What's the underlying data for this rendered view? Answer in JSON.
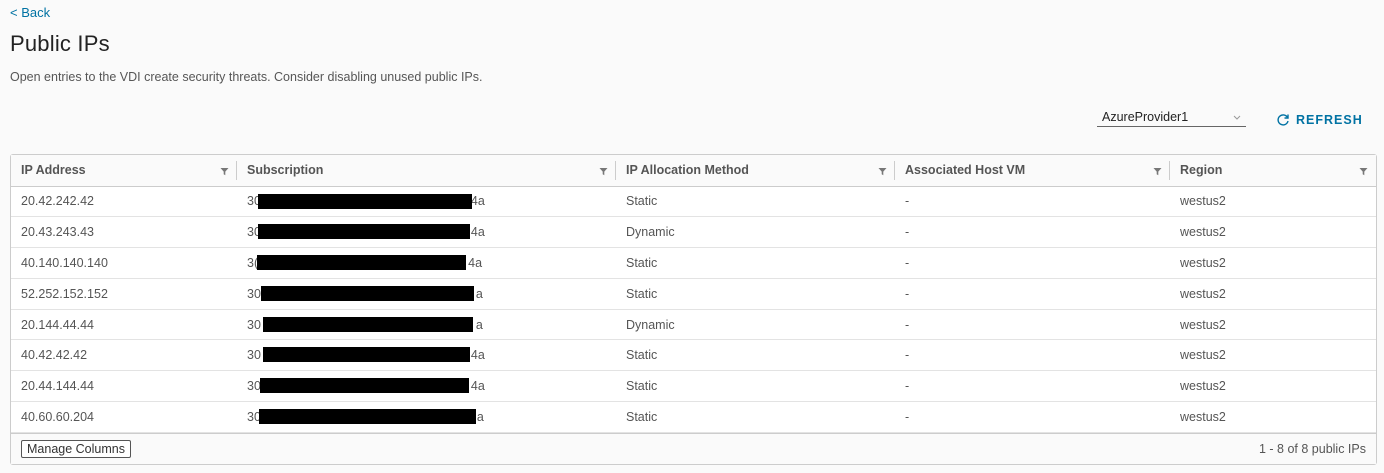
{
  "nav": {
    "back_label": "< Back"
  },
  "page": {
    "title": "Public IPs",
    "description": "Open entries to the VDI create security threats. Consider disabling unused public IPs."
  },
  "toolbar": {
    "provider_selected": "AzureProvider1",
    "refresh_label": "REFRESH"
  },
  "table": {
    "columns": [
      "IP Address",
      "Subscription",
      "IP Allocation Method",
      "Associated Host VM",
      "Region"
    ],
    "rows": [
      {
        "ip": "20.42.242.42",
        "sub_prefix": "30",
        "sub_suffix": "4a",
        "method": "Static",
        "vm": "-",
        "region": "westus2"
      },
      {
        "ip": "20.43.243.43",
        "sub_prefix": "30",
        "sub_suffix": "4a",
        "method": "Dynamic",
        "vm": "-",
        "region": "westus2"
      },
      {
        "ip": "40.140.140.140",
        "sub_prefix": "3(",
        "sub_suffix": "4a",
        "method": "Static",
        "vm": "-",
        "region": "westus2"
      },
      {
        "ip": "52.252.152.152",
        "sub_prefix": "30",
        "sub_suffix": "a",
        "method": "Static",
        "vm": "-",
        "region": "westus2"
      },
      {
        "ip": "20.144.44.44",
        "sub_prefix": "30",
        "sub_suffix": "a",
        "method": "Dynamic",
        "vm": "-",
        "region": "westus2"
      },
      {
        "ip": "40.42.42.42",
        "sub_prefix": "30",
        "sub_suffix": "4a",
        "method": "Static",
        "vm": "-",
        "region": "westus2"
      },
      {
        "ip": "20.44.144.44",
        "sub_prefix": "30",
        "sub_suffix": "4a",
        "method": "Static",
        "vm": "-",
        "region": "westus2"
      },
      {
        "ip": "40.60.60.204",
        "sub_prefix": "30",
        "sub_suffix": "a",
        "method": "Static",
        "vm": "-",
        "region": "westus2"
      }
    ]
  },
  "footer": {
    "manage_columns_label": "Manage Columns",
    "pagination_text": "1 - 8 of 8 public IPs"
  },
  "colors": {
    "link": "#0072a3",
    "redaction": "#000000"
  }
}
